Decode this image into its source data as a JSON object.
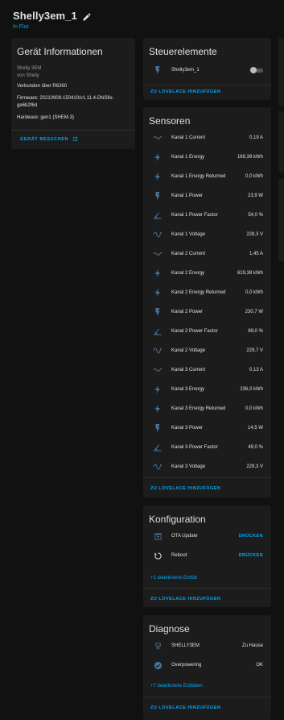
{
  "header": {
    "title": "Shelly3em_1",
    "area": "In Flur"
  },
  "device_info": {
    "title": "Gerät Informationen",
    "model": "Shelly 3EM",
    "manufacturer": "von Shelly",
    "connected": "Verbunden über R6260",
    "firmware_line1": "Firmware: 20210909-150410/v1.11.4-DNSfix-",
    "firmware_line2": "ge6b2f6d",
    "hardware": "Hardware: gen1 (SHEM-3)",
    "visit_label": "GERÄT BESUCHEN"
  },
  "controls": {
    "title": "Steuerelemente",
    "items": [
      {
        "label": "Shelly3em_1",
        "icon": "flash-icon",
        "state": "off"
      }
    ],
    "add_label": "ZU LOVELACE HINZUFÜGEN"
  },
  "sensors": {
    "title": "Sensoren",
    "items": [
      {
        "label": "Kanal 1 Current",
        "value": "0,19 A",
        "icon": "current-ac-icon"
      },
      {
        "label": "Kanal 1 Energy",
        "value": "169,39 kWh",
        "icon": "lightning-icon"
      },
      {
        "label": "Kanal 1 Energy Returned",
        "value": "0,0 kWh",
        "icon": "lightning-icon"
      },
      {
        "label": "Kanal 1 Power",
        "value": "23,9 W",
        "icon": "flash-icon"
      },
      {
        "label": "Kanal 1 Power Factor",
        "value": "54,0 %",
        "icon": "angle-acute-icon"
      },
      {
        "label": "Kanal 1 Voltage",
        "value": "228,3 V",
        "icon": "sine-wave-icon"
      },
      {
        "label": "Kanal 2 Current",
        "value": "1,45 A",
        "icon": "current-ac-icon"
      },
      {
        "label": "Kanal 2 Energy",
        "value": "619,38 kWh",
        "icon": "lightning-icon"
      },
      {
        "label": "Kanal 2 Energy Returned",
        "value": "0,0 kWh",
        "icon": "lightning-icon"
      },
      {
        "label": "Kanal 2 Power",
        "value": "230,7 W",
        "icon": "flash-icon"
      },
      {
        "label": "Kanal 2 Power Factor",
        "value": "69,0 %",
        "icon": "angle-acute-icon"
      },
      {
        "label": "Kanal 2 Voltage",
        "value": "229,7 V",
        "icon": "sine-wave-icon"
      },
      {
        "label": "Kanal 3 Current",
        "value": "0,13 A",
        "icon": "current-ac-icon"
      },
      {
        "label": "Kanal 3 Energy",
        "value": "236,0 kWh",
        "icon": "lightning-icon"
      },
      {
        "label": "Kanal 3 Energy Returned",
        "value": "0,0 kWh",
        "icon": "lightning-icon"
      },
      {
        "label": "Kanal 3 Power",
        "value": "14,5 W",
        "icon": "flash-icon"
      },
      {
        "label": "Kanal 3 Power Factor",
        "value": "49,0 %",
        "icon": "angle-acute-icon"
      },
      {
        "label": "Kanal 3 Voltage",
        "value": "229,3 V",
        "icon": "sine-wave-icon"
      }
    ],
    "add_label": "ZU LOVELACE HINZUFÜGEN"
  },
  "config": {
    "title": "Konfiguration",
    "items": [
      {
        "label": "OTA Update",
        "action": "DRÜCKEN",
        "icon": "package-up-icon"
      },
      {
        "label": "Reboot",
        "action": "DRÜCKEN",
        "icon": "restart-icon"
      }
    ],
    "disabled_label": "+1 deaktivierte Entität",
    "add_label": "ZU LOVELACE HINZUFÜGEN"
  },
  "diagnostics": {
    "title": "Diagnose",
    "items": [
      {
        "label": "SHELLY3EM",
        "value": "Zu Hause",
        "icon": "router-icon"
      },
      {
        "label": "Overpowering",
        "value": "OK",
        "icon": "check-circle-icon"
      }
    ],
    "disabled_label": "+7 deaktivierte Entitäten",
    "add_label": "ZU LOVELACE HINZUFÜGEN"
  },
  "colors": {
    "accent": "#03a9f4",
    "icon": "#44739e",
    "card": "#1c1c1c",
    "background": "#111111"
  }
}
